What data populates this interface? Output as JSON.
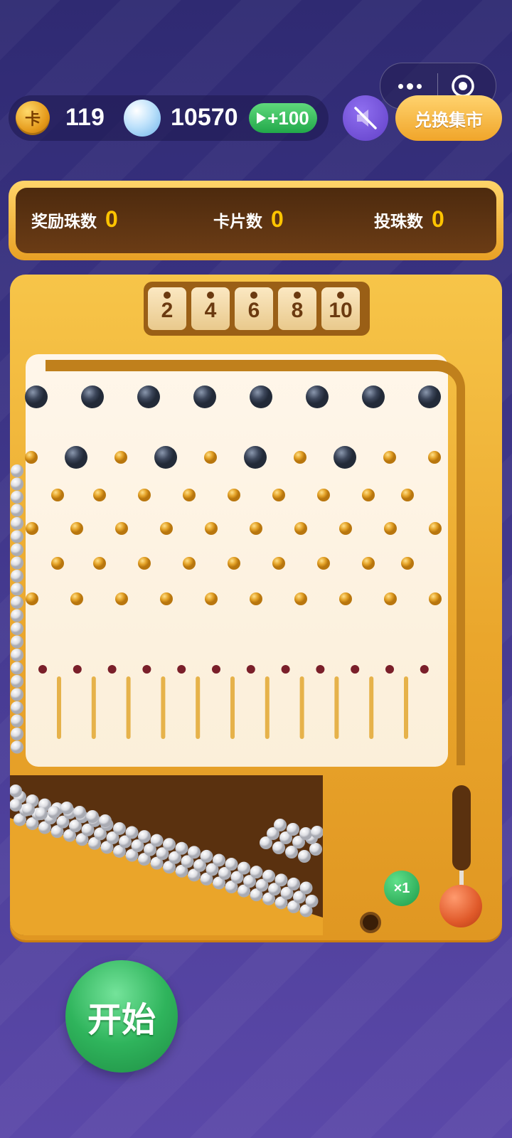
{
  "topbar": {
    "card_icon_glyph": "卡",
    "card_count": "119",
    "pearl_count": "10570",
    "ad_bonus_label": "+100",
    "exchange_label": "兑换集市",
    "mute_icon": "speaker-muted-icon",
    "more_icon": "more-dots-icon",
    "close_icon": "target-circle-icon"
  },
  "stats": {
    "reward_beads_label": "奖励珠数",
    "reward_beads_value": "0",
    "cards_label": "卡片数",
    "cards_value": "0",
    "thrown_beads_label": "投珠数",
    "thrown_beads_value": "0"
  },
  "board": {
    "slots": [
      "2",
      "4",
      "6",
      "8",
      "10"
    ],
    "multiplier_label": "×1"
  },
  "start_label": "开始",
  "colors": {
    "accent_gold": "#f0a52a",
    "panel_brown": "#5a310f",
    "start_green": "#2fb45c",
    "background_purple": "#3c3485"
  }
}
